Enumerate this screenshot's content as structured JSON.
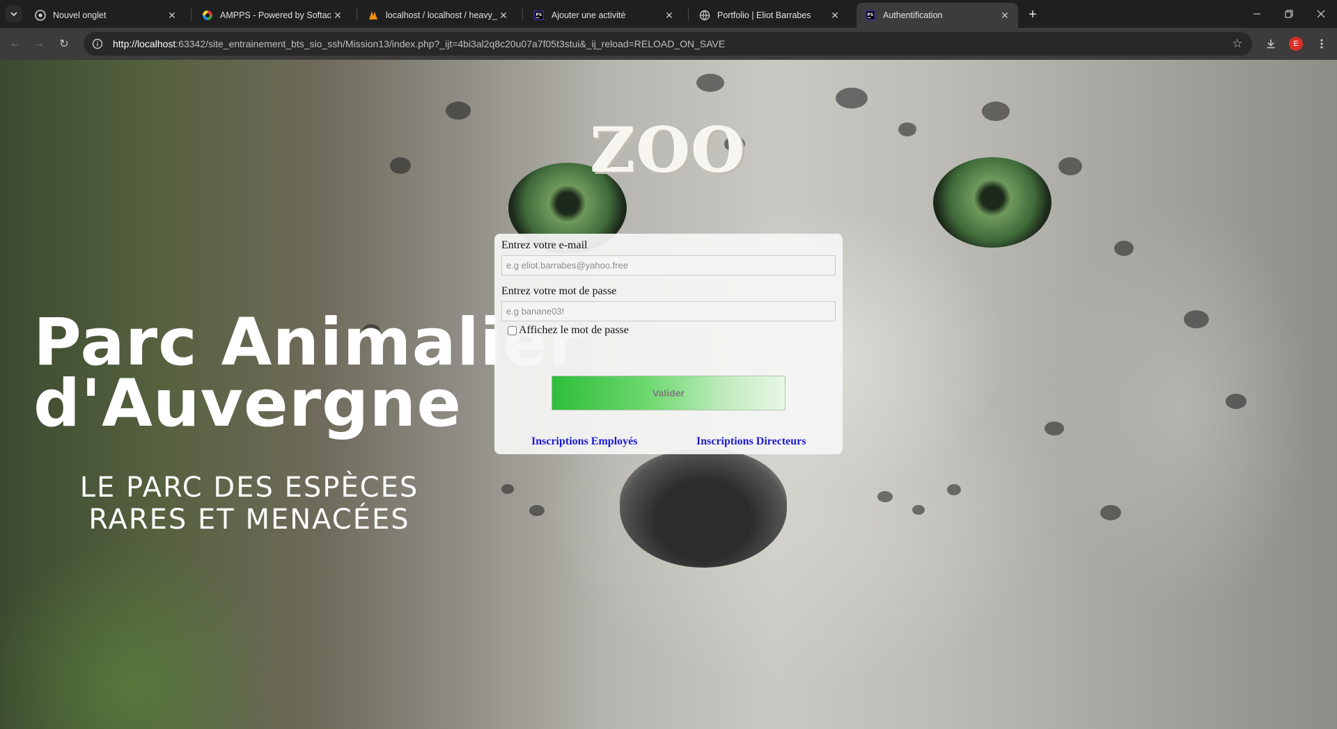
{
  "browser": {
    "tabs": [
      {
        "title": "Nouvel onglet",
        "icon": "chrome-icon",
        "active": false
      },
      {
        "title": "AMPPS - Powered by Softaculous",
        "icon": "ampps-icon",
        "active": false
      },
      {
        "title": "localhost / localhost / heavy_ap",
        "icon": "phpmyadmin-icon",
        "active": false
      },
      {
        "title": "Ajouter une activité",
        "icon": "phpstorm-icon",
        "active": false
      },
      {
        "title": "Portfolio | Eliot Barrabes",
        "icon": "globe-icon",
        "active": false
      },
      {
        "title": "Authentification",
        "icon": "phpstorm-icon",
        "active": true
      }
    ],
    "address": {
      "host": "http://localhost",
      "rest": ":63342/site_entrainement_bts_sio_ssh/Mission13/index.php?_ijt=4bi3al2q8c20u07a7f05t3stui&_ij_reload=RELOAD_ON_SAVE"
    },
    "profile_initial": "E"
  },
  "page": {
    "title": "ZOO",
    "logo": {
      "line1": "Parc Animalier",
      "line2": "d'Auvergne",
      "tagline_line1": "LE PARC DES ESPÈCES",
      "tagline_line2": "RARES ET MENACÉES"
    },
    "form": {
      "email_label": "Entrez votre e-mail",
      "email_placeholder": "e.g eliot.barrabes@yahoo.free",
      "password_label": "Entrez votre mot de passe",
      "password_placeholder": "e.g banane03!",
      "show_password_label": "Affichez le mot de passe",
      "submit_label": "Valider",
      "link_employees": "Inscriptions Employés",
      "link_directors": "Inscriptions Directeurs"
    }
  }
}
